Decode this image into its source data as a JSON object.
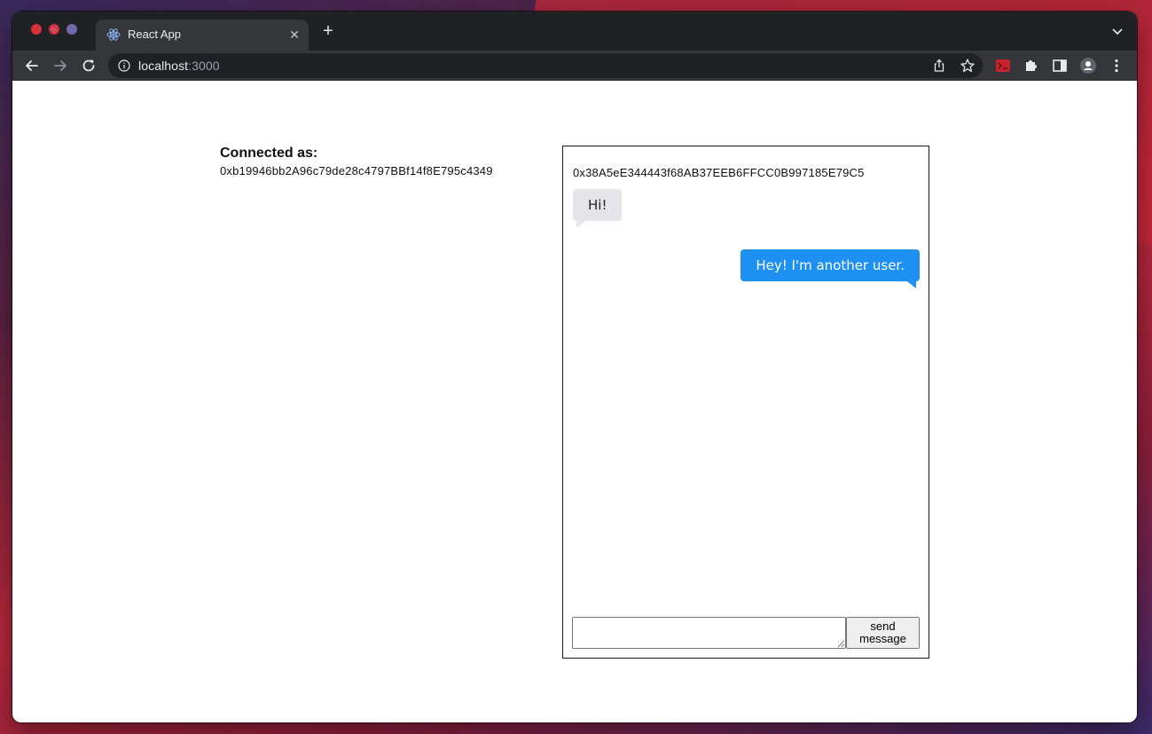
{
  "browser": {
    "tab": {
      "title": "React App",
      "favicon": "react-atom-icon",
      "close_glyph": "✕"
    },
    "new_tab_glyph": "+",
    "address_bar": {
      "host": "localhost",
      "port": ":3000"
    },
    "toolbar_icons": [
      "back-icon",
      "forward-icon",
      "reload-icon",
      "info-icon",
      "share-icon",
      "star-icon",
      "extension-red-icon",
      "puzzle-icon",
      "side-panel-icon",
      "profile-icon",
      "menu-icon"
    ]
  },
  "app": {
    "connected_label": "Connected as:",
    "connected_address": "0xb19946bb2A96c79de28c4797BBf14f8E795c4349",
    "chat": {
      "peer_address": "0x38A5eE344443f68AB37EEB6FFCC0B997185E79C5",
      "messages": [
        {
          "direction": "incoming",
          "text": "Hi!"
        },
        {
          "direction": "outgoing",
          "text": "Hey! I'm another user."
        }
      ],
      "input_value": "",
      "send_label": "send message"
    }
  },
  "colors": {
    "incoming_bubble": "#e5e5ea",
    "outgoing_bubble": "#1e90f2",
    "browser_frame": "#202124",
    "toolbar": "#35363a"
  }
}
